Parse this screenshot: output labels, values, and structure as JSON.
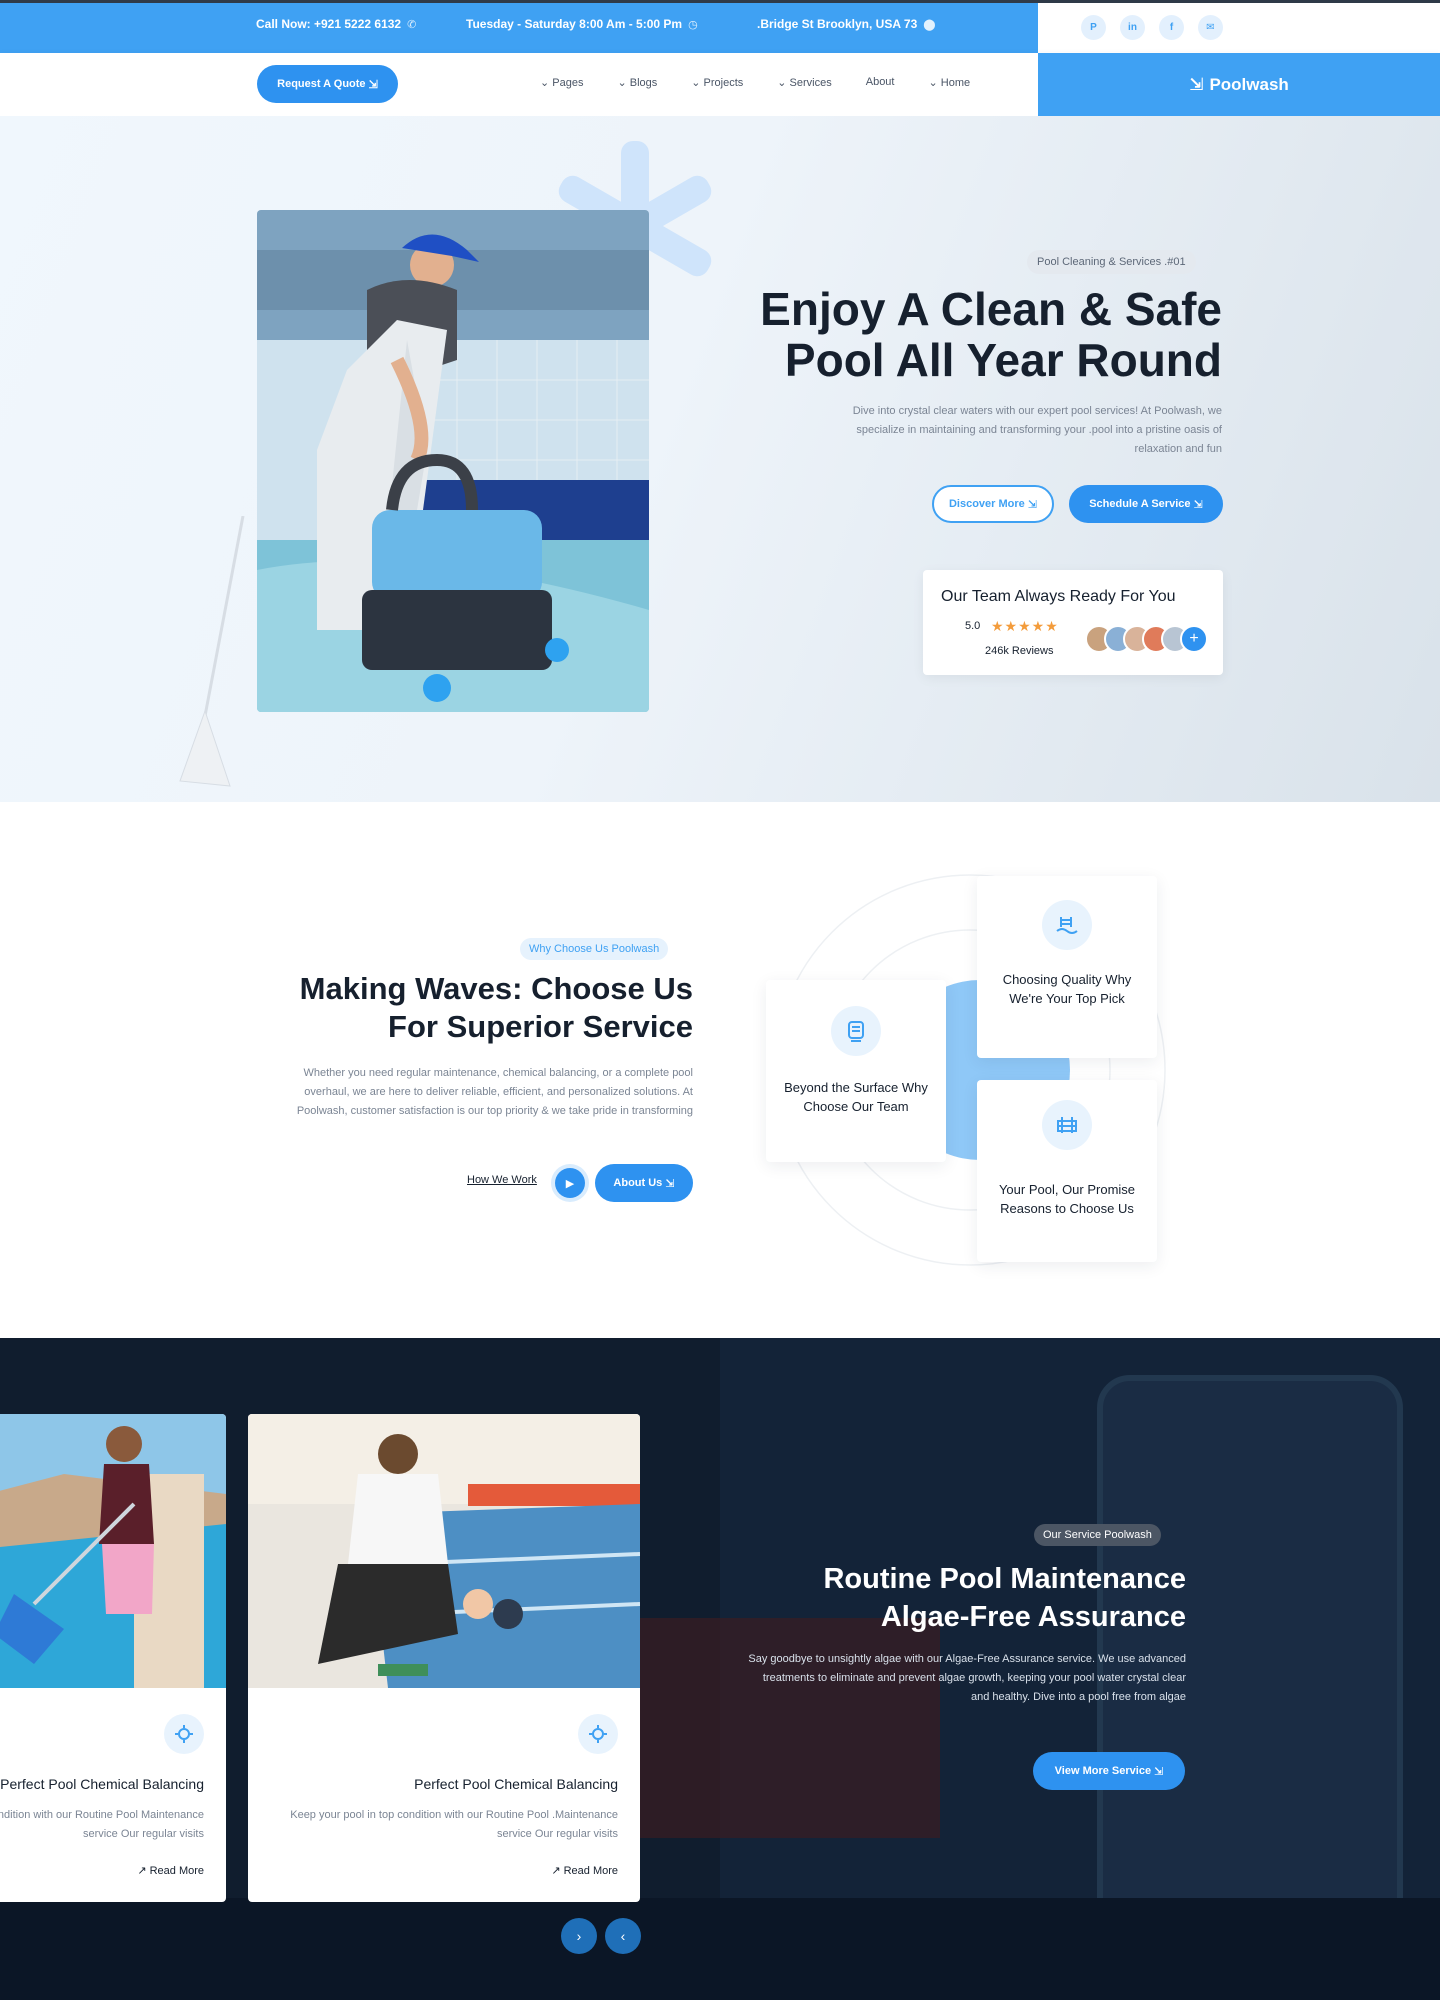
{
  "topbar": {
    "phone": "Call Now: +921 5222 6132",
    "hours": "Tuesday - Saturday 8:00 Am - 5:00 Pm",
    "address": ".Bridge St Brooklyn, USA 73",
    "socials": [
      "P",
      "in",
      "f",
      "✉"
    ]
  },
  "nav": {
    "quote_label": "Request A Quote",
    "menu": [
      "⌄ Pages",
      "⌄ Blogs",
      "⌄ Projects",
      "⌄ Services",
      "About",
      "⌄ Home"
    ],
    "brand": "Poolwash"
  },
  "hero": {
    "tag": "Pool Cleaning & Services .#01",
    "title_line1": "Enjoy A Clean & Safe",
    "title_line2": "Pool All Year Round",
    "description": "Dive into crystal clear waters with our expert pool services! At Poolwash, we specialize in maintaining and transforming your .pool into a pristine oasis of relaxation and fun",
    "discover_label": "Discover More",
    "schedule_label": "Schedule A Service",
    "review_title": "Our Team Always Ready For You",
    "rating": "5.0",
    "stars": "★★★★★",
    "reviews": "246k Reviews",
    "avatar_plus": "+"
  },
  "why": {
    "tag": "Why Choose Us Poolwash",
    "title_line1": "Making Waves: Choose Us",
    "title_line2": "For Superior Service",
    "description": "Whether you need regular maintenance, chemical balancing, or a complete pool overhaul, we are here to deliver reliable, efficient, and personalized solutions. At Poolwash, customer satisfaction is our top priority & we take pride in transforming",
    "how_label": "How We Work",
    "about_label": "About Us",
    "cards": [
      "Choosing Quality Why We're Your Top Pick",
      "Beyond the Surface Why Choose Our Team",
      "Your Pool, Our Promise Reasons to Choose Us"
    ]
  },
  "services": {
    "tag": "Our Service Poolwash",
    "title_line1": "Routine Pool Maintenance",
    "title_line2": "Algae-Free Assurance",
    "description": "Say goodbye to unsightly algae with our Algae-Free Assurance service. We use advanced treatments to eliminate and prevent algae growth, keeping your pool water crystal clear and healthy. Dive into a pool free from algae",
    "view_label": "View More Service",
    "cards": [
      {
        "title": "Perfect Pool Chemical Balancing",
        "desc": "Keep your pool in top condition with our Routine Pool Maintenance service Our regular visits",
        "more": "↗ Read More"
      },
      {
        "title": "Perfect Pool Chemical Balancing",
        "desc": "Keep your pool in top condition with our Routine Pool .Maintenance service Our regular visits",
        "more": "↗ Read More"
      }
    ],
    "next": "›",
    "prev": "‹"
  },
  "colors": {
    "accent": "#3fa1f3",
    "button": "#2e92f0",
    "dark": "#16202e",
    "star": "#f39c3c"
  }
}
